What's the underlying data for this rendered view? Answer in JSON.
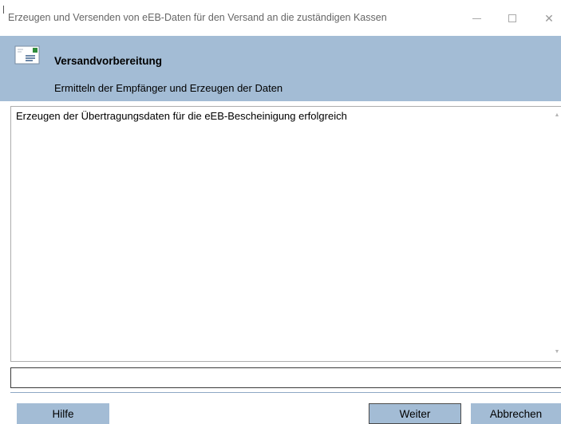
{
  "window": {
    "title": "Erzeugen und Versenden von eEB-Daten für den Versand an die zuständigen Kassen",
    "controls": {
      "minimize_icon": "minimize-icon",
      "maximize_icon": "maximize-icon",
      "close_icon": "close-icon",
      "close_glyph": "✕"
    }
  },
  "header": {
    "icon": "envelope-document-icon",
    "title": "Versandvorbereitung",
    "subtitle": "Ermitteln der Empfänger und Erzeugen der Daten",
    "background": "#a3bcd5"
  },
  "log": {
    "lines": [
      "Erzeugen der Übertragungsdaten für die eEB-Bescheinigung erfolgreich"
    ],
    "scroll_up_glyph": "▲",
    "scroll_down_glyph": "▼"
  },
  "status": {
    "value": ""
  },
  "buttons": {
    "help": "Hilfe",
    "next": "Weiter",
    "cancel": "Abbrechen",
    "background": "#a3bcd5"
  }
}
